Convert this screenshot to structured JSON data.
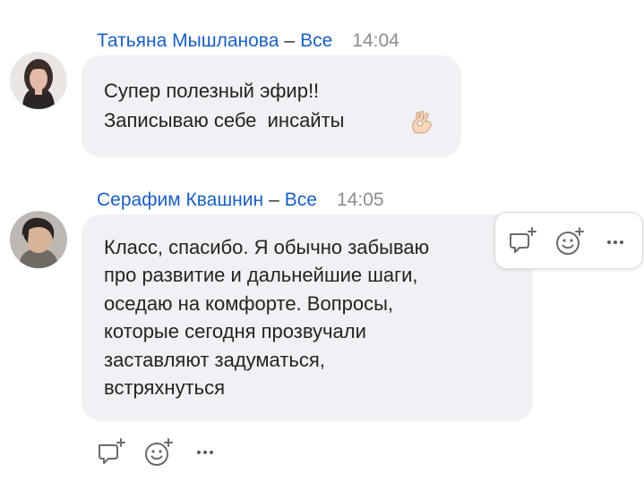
{
  "messages": [
    {
      "sender": "Татьяна Мышланова",
      "separator": "–",
      "recipient": "Все",
      "time": "14:04",
      "text_lines": [
        "Супер полезный эфир!!",
        "Записываю себе  инсайты"
      ],
      "emoji": "ok-hand-emoji",
      "avatar": "female-avatar-photo"
    },
    {
      "sender": "Серафим Квашнин",
      "separator": "–",
      "recipient": "Все",
      "time": "14:05",
      "text_lines": [
        "Класс, спасибо. Я обычно забываю",
        "про развитие и дальнейшие шаги,",
        "оседаю на комфорте. Вопросы,",
        "которые сегодня прозвучали",
        "заставляют задуматься,",
        "встряхнуться"
      ],
      "avatar": "male-avatar-photo"
    }
  ],
  "actions": {
    "reply_icon": "reply-comment-plus-icon",
    "reaction_icon": "add-reaction-smiley-icon",
    "more_icon": "more-dots-icon"
  },
  "colors": {
    "name": "#1a5fc0",
    "time": "#8c8c8c",
    "bubble": "#f1f1f5",
    "text": "#232323",
    "icon": "#6b6b6b"
  }
}
